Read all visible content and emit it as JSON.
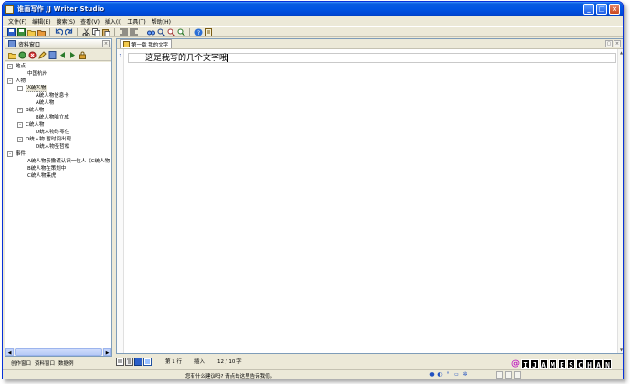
{
  "window": {
    "title": "谁画写作 JJ Writer Studio",
    "controls": {
      "minimize": "_",
      "maximize": "□",
      "close": "×"
    }
  },
  "menu": [
    {
      "label": "文件(F)"
    },
    {
      "label": "编辑(E)"
    },
    {
      "label": "搜索(S)"
    },
    {
      "label": "查看(V)"
    },
    {
      "label": "插入(I)"
    },
    {
      "label": "工具(T)"
    },
    {
      "label": "帮助(H)"
    }
  ],
  "left_panel": {
    "title": "资料窗口",
    "close_label": "×",
    "tree": [
      {
        "label": "地点",
        "depth": 0,
        "toggle": "-"
      },
      {
        "label": "中国杭州",
        "depth": 1,
        "toggle": ""
      },
      {
        "label": "人物",
        "depth": 0,
        "toggle": "-"
      },
      {
        "label": "A统人物",
        "depth": 1,
        "toggle": "-",
        "selected": true
      },
      {
        "label": "A统人物信息卡",
        "depth": 2,
        "toggle": ""
      },
      {
        "label": "A统人物",
        "depth": 2,
        "toggle": ""
      },
      {
        "label": "B统人物",
        "depth": 1,
        "toggle": "-"
      },
      {
        "label": "B统人物喻立成",
        "depth": 2,
        "toggle": ""
      },
      {
        "label": "C统人物",
        "depth": 1,
        "toggle": "-"
      },
      {
        "label": "D统人物珍零住",
        "depth": 2,
        "toggle": ""
      },
      {
        "label": "D统人物 暂时间出现",
        "depth": 1,
        "toggle": "-"
      },
      {
        "label": "D统人物圣哲松",
        "depth": 2,
        "toggle": ""
      },
      {
        "label": "事件",
        "depth": 0,
        "toggle": "-"
      },
      {
        "label": "A统人物亲撒谎认识一位人《C统人物",
        "depth": 1,
        "toggle": ""
      },
      {
        "label": "B统人物在策划中",
        "depth": 1,
        "toggle": ""
      },
      {
        "label": "C统人物集虎",
        "depth": 1,
        "toggle": ""
      }
    ]
  },
  "bottom_tabs": [
    {
      "label": "创作窗口"
    },
    {
      "label": "资料窗口"
    },
    {
      "label": "数据例"
    }
  ],
  "editor": {
    "tab_label": "第一章 我的文字",
    "line_number": "1",
    "text": "这是我写的几个文字哦"
  },
  "editor_status": {
    "line": "第 1 行",
    "mode": "插入",
    "count": "12 / 10 字"
  },
  "status_bar": {
    "hint": "您有什么建议吗? 请点击这里告诉我们。"
  },
  "watermark": {
    "at": "@",
    "letters": [
      "I",
      "J",
      "A",
      "M",
      "E",
      "S",
      "C",
      "H",
      "A",
      "N"
    ]
  }
}
